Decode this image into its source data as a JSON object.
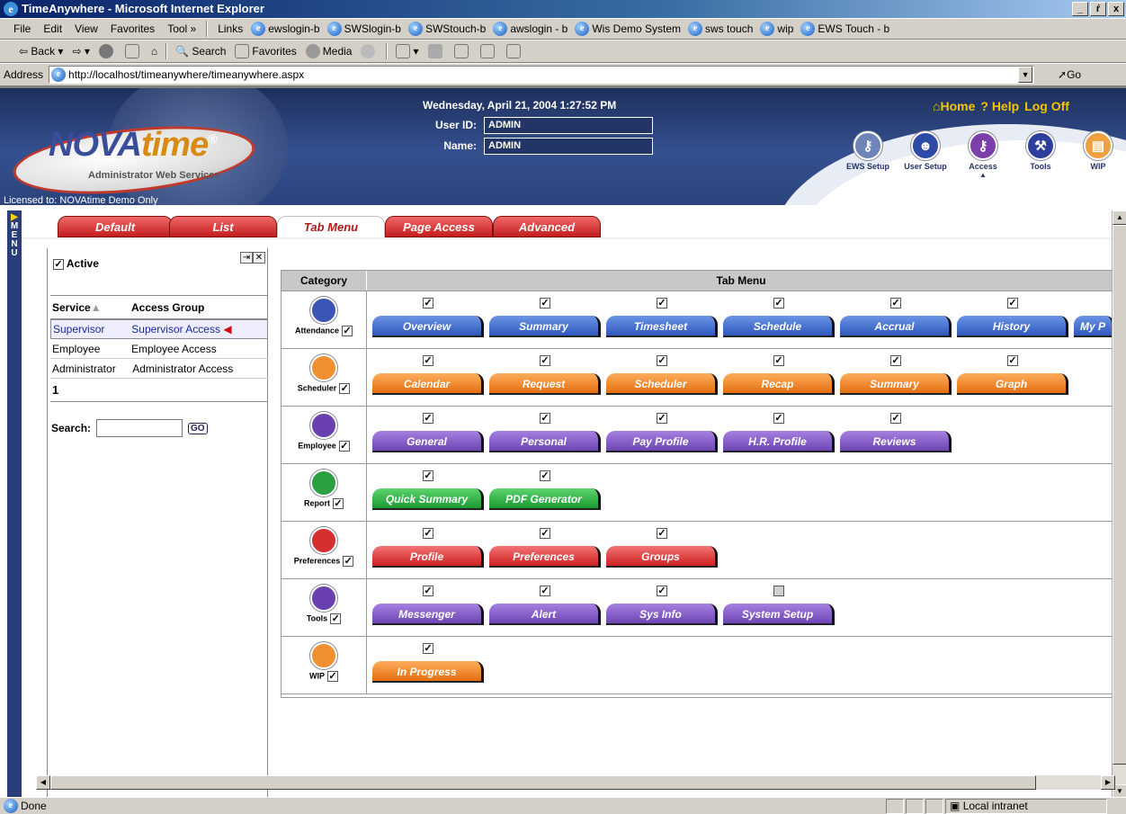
{
  "window": {
    "title": "TimeAnywhere - Microsoft Internet Explorer",
    "buttons": [
      "_",
      "ŕ",
      "x"
    ]
  },
  "menu": [
    "File",
    "Edit",
    "View",
    "Favorites",
    "Tool »"
  ],
  "links": {
    "label": "Links",
    "items": [
      "ewslogin-b",
      "SWSlogin-b",
      "SWStouch-b",
      "awslogin - b",
      "Wis Demo System",
      "sws touch",
      "wip",
      "EWS Touch - b"
    ]
  },
  "toolbar": {
    "back": "Back",
    "search": "Search",
    "favorites": "Favorites",
    "media": "Media"
  },
  "address": {
    "label": "Address",
    "url": "http://localhost/timeanywhere/timeanywhere.aspx",
    "go": "Go"
  },
  "header": {
    "brand": "NOVAtime",
    "brand_sub": "Administrator Web Services",
    "licensed": "Licensed to: NOVAtime Demo Only",
    "datetime": "Wednesday, April 21, 2004 1:27:52 PM",
    "user_id_label": "User ID:",
    "user_id": "ADMIN",
    "name_label": "Name:",
    "name": "ADMIN",
    "home": "Home",
    "help": "? Help",
    "logoff": "Log Off",
    "nav": [
      "EWS Setup",
      "User Setup",
      "Access",
      "Tools",
      "WIP"
    ]
  },
  "menu_strip": [
    "M",
    "E",
    "N",
    "U"
  ],
  "tabs": [
    "Default",
    "List",
    "Tab Menu",
    "Page Access",
    "Advanced"
  ],
  "left": {
    "active_label": "Active",
    "col_service": "Service",
    "col_group": "Access Group",
    "rows": [
      {
        "service": "Supervisor",
        "group": "Supervisor Access"
      },
      {
        "service": "Employee",
        "group": "Employee Access"
      },
      {
        "service": "Administrator",
        "group": "Administrator Access"
      }
    ],
    "page": "1",
    "search_label": "Search:",
    "go": "GO"
  },
  "grid": {
    "col_category": "Category",
    "col_tabmenu": "Tab Menu",
    "rows": [
      {
        "category": "Attendance",
        "color": "blue",
        "tabs": [
          "Overview",
          "Summary",
          "Timesheet",
          "Schedule",
          "Accrual",
          "History",
          "My P"
        ]
      },
      {
        "category": "Scheduler",
        "color": "orange",
        "tabs": [
          "Calendar",
          "Request",
          "Scheduler",
          "Recap",
          "Summary",
          "Graph"
        ]
      },
      {
        "category": "Employee",
        "color": "purple",
        "tabs": [
          "General",
          "Personal",
          "Pay Profile",
          "H.R. Profile",
          "Reviews"
        ]
      },
      {
        "category": "Report",
        "color": "green",
        "tabs": [
          "Quick Summary",
          "PDF Generator"
        ]
      },
      {
        "category": "Preferences",
        "color": "red",
        "tabs": [
          "Profile",
          "Preferences",
          "Groups"
        ]
      },
      {
        "category": "Tools",
        "color": "purple",
        "tabs": [
          "Messenger",
          "Alert",
          "Sys Info",
          "System Setup"
        ]
      },
      {
        "category": "WIP",
        "color": "orange",
        "tabs": [
          "In Progress"
        ]
      }
    ]
  },
  "status": {
    "left": "Done",
    "zone": "Local intranet"
  }
}
